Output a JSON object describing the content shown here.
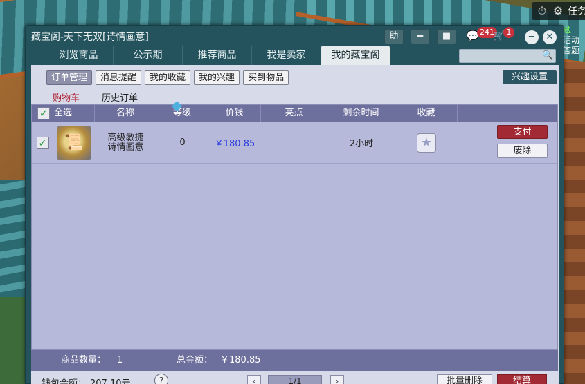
{
  "hud": {
    "task_label": "任务"
  },
  "side_notes": [
    "题",
    "活动",
    "答题"
  ],
  "window": {
    "title": "藏宝阁-天下无双[诗情画意]",
    "help_label": "助",
    "message_count": "241",
    "cart_count": "1"
  },
  "tabs": [
    {
      "label": "浏览商品"
    },
    {
      "label": "公示期"
    },
    {
      "label": "推荐商品"
    },
    {
      "label": "我是卖家"
    },
    {
      "label": "我的藏宝阁"
    }
  ],
  "search": {
    "placeholder": ""
  },
  "subtabs": [
    {
      "label": "订单管理"
    },
    {
      "label": "消息提醒"
    },
    {
      "label": "我的收藏"
    },
    {
      "label": "我的兴趣"
    },
    {
      "label": "买到物品"
    }
  ],
  "interest_settings_label": "兴趣设置",
  "cart_links": {
    "cart": "购物车",
    "history": "历史订单"
  },
  "table": {
    "columns": [
      "全选",
      "名称",
      "等级",
      "价钱",
      "亮点",
      "剩余时间",
      "收藏"
    ],
    "rows": [
      {
        "name_line1": "高级敏捷",
        "name_line2": "诗情画意",
        "level": "0",
        "price": "￥180.85",
        "highlight": "",
        "time_left": "2小时",
        "pay_label": "支付",
        "remove_label": "废除"
      }
    ]
  },
  "summary": {
    "count_label": "商品数量：",
    "count": "1",
    "total_label": "总金额：",
    "total": "￥180.85"
  },
  "bottom": {
    "wallet_label": "钱包余额：",
    "wallet_value": "207.10元",
    "page": "1/1",
    "batch_delete": "批量删除",
    "settle": "结算"
  },
  "colors": {
    "window_bg": "#24535e",
    "content_bg": "#d7dbe9",
    "header_bar": "#6d6f9d",
    "pay_red": "#a22a34",
    "price_blue": "#2a3cdc"
  }
}
